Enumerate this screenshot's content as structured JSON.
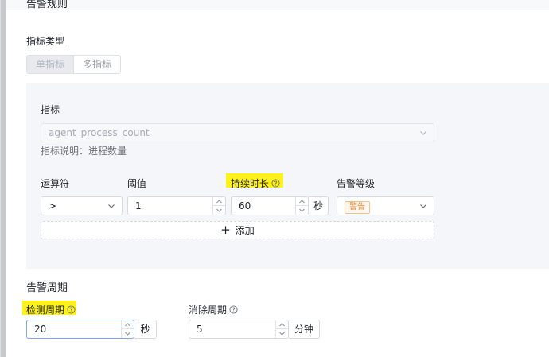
{
  "section": {
    "title": "告警规则"
  },
  "metric_type": {
    "label": "指标类型",
    "options": [
      "单指标",
      "多指标"
    ],
    "selected": "单指标"
  },
  "metric": {
    "label": "指标",
    "placeholder": "agent_process_count",
    "description": "指标说明：进程数量"
  },
  "condition": {
    "operator_label": "运算符",
    "threshold_label": "阈值",
    "duration_label": "持续时长",
    "level_label": "告警等级",
    "operator_value": ">",
    "threshold_value": "1",
    "duration_value": "60",
    "duration_unit": "秒",
    "level_value": "警告",
    "level_color": "#e8872f"
  },
  "add_button": {
    "label": "添加",
    "icon": "plus-icon"
  },
  "alarm_period": {
    "title": "告警周期",
    "detect_label": "检测周期",
    "detect_value": "20",
    "detect_unit": "秒",
    "clear_label": "消除周期",
    "clear_value": "5",
    "clear_unit": "分钟"
  },
  "colors": {
    "highlight": "#fff21a",
    "accent": "#7ea6f2",
    "panel_bg": "#f5f6f9"
  }
}
